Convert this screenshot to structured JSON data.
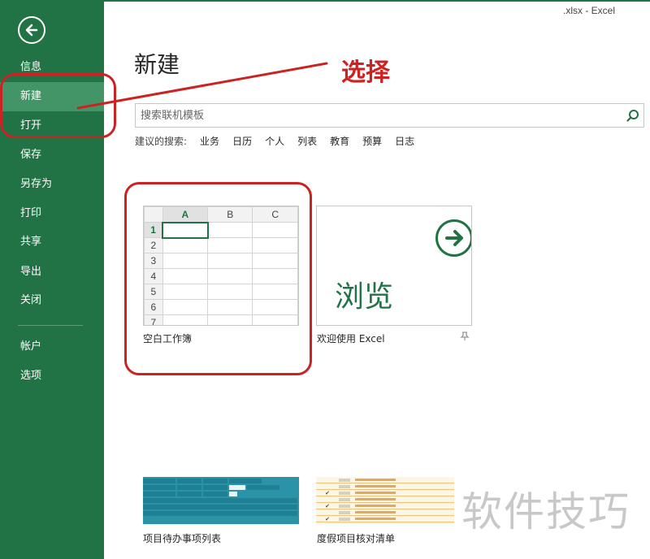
{
  "window": {
    "title": ".xlsx - Excel"
  },
  "sidebar": {
    "items": [
      {
        "label": "信息"
      },
      {
        "label": "新建"
      },
      {
        "label": "打开"
      },
      {
        "label": "保存"
      },
      {
        "label": "另存为"
      },
      {
        "label": "打印"
      },
      {
        "label": "共享"
      },
      {
        "label": "导出"
      },
      {
        "label": "关闭"
      },
      {
        "label": "帐户"
      },
      {
        "label": "选项"
      }
    ]
  },
  "main": {
    "title": "新建",
    "search": {
      "placeholder": "搜索联机模板"
    },
    "suggested": {
      "label": "建议的搜索:",
      "links": [
        "业务",
        "日历",
        "个人",
        "列表",
        "教育",
        "预算",
        "日志"
      ]
    },
    "templates": [
      {
        "caption": "空白工作簿",
        "columns": [
          "A",
          "B",
          "C"
        ],
        "rows": [
          "1",
          "2",
          "3",
          "4",
          "5",
          "6",
          "7"
        ]
      },
      {
        "caption": "欢迎使用 Excel",
        "thumb_text": "浏览"
      },
      {
        "caption": "项目待办事项列表"
      },
      {
        "caption": "度假项目核对清单"
      }
    ]
  },
  "annotation": {
    "label": "选择",
    "color": "#cc2222"
  },
  "watermark": "软件技巧",
  "colors": {
    "accent": "#217346",
    "selected": "#439467"
  }
}
